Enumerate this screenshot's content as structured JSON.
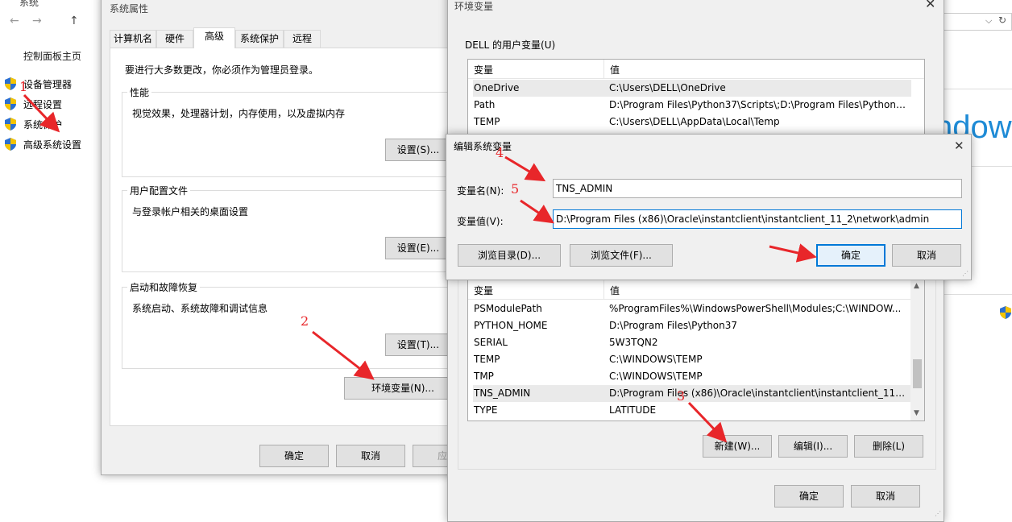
{
  "bg": {
    "title": "系统",
    "left_nav": [
      "控制面板主页",
      "设备管理器",
      "远程设置",
      "系统保护",
      "高级系统设置"
    ],
    "right_text": "ndow"
  },
  "sysprops": {
    "title": "系统属性",
    "tabs": [
      "计算机名",
      "硬件",
      "高级",
      "系统保护",
      "远程"
    ],
    "active_tab": "高级",
    "admin_note": "要进行大多数更改，你必须作为管理员登录。",
    "performance": {
      "title": "性能",
      "desc": "视觉效果，处理器计划，内存使用，以及虚拟内存",
      "button": "设置(S)..."
    },
    "profile": {
      "title": "用户配置文件",
      "desc": "与登录帐户相关的桌面设置",
      "button": "设置(E)..."
    },
    "startup": {
      "title": "启动和故障恢复",
      "desc": "系统启动、系统故障和调试信息",
      "button": "设置(T)..."
    },
    "env_button": "环境变量(N)...",
    "ok": "确定",
    "cancel": "取消",
    "apply": "应用"
  },
  "envvars": {
    "title": "环境变量",
    "user_section": "DELL 的用户变量(U)",
    "col_var": "变量",
    "col_val": "值",
    "user_rows": [
      {
        "name": "OneDrive",
        "value": "C:\\Users\\DELL\\OneDrive"
      },
      {
        "name": "Path",
        "value": "D:\\Program Files\\Python37\\Scripts\\;D:\\Program Files\\Python3..."
      },
      {
        "name": "TEMP",
        "value": "C:\\Users\\DELL\\AppData\\Local\\Temp"
      }
    ],
    "sys_rows": [
      {
        "name": "PSModulePath",
        "value": "%ProgramFiles%\\WindowsPowerShell\\Modules;C:\\WINDOW..."
      },
      {
        "name": "PYTHON_HOME",
        "value": "D:\\Program Files\\Python37"
      },
      {
        "name": "SERIAL",
        "value": "5W3TQN2"
      },
      {
        "name": "TEMP",
        "value": "C:\\WINDOWS\\TEMP"
      },
      {
        "name": "TMP",
        "value": "C:\\WINDOWS\\TEMP"
      },
      {
        "name": "TNS_ADMIN",
        "value": "D:\\Program Files (x86)\\Oracle\\instantclient\\instantclient_11_2\\..."
      },
      {
        "name": "TYPE",
        "value": "LATITUDE"
      }
    ],
    "new_button": "新建(W)...",
    "edit_button": "编辑(I)...",
    "delete_button": "删除(L)",
    "ok": "确定",
    "cancel": "取消"
  },
  "editdlg": {
    "title": "编辑系统变量",
    "name_label": "变量名(N):",
    "name_value": "TNS_ADMIN",
    "value_label": "变量值(V):",
    "value_value": "D:\\Program Files (x86)\\Oracle\\instantclient\\instantclient_11_2\\network\\admin",
    "browse_dir": "浏览目录(D)...",
    "browse_file": "浏览文件(F)...",
    "ok": "确定",
    "cancel": "取消"
  },
  "annotations": [
    "1",
    "2",
    "3",
    "4",
    "5"
  ],
  "colors": {
    "arrow": "#e8262a",
    "accent": "#0078d7"
  }
}
